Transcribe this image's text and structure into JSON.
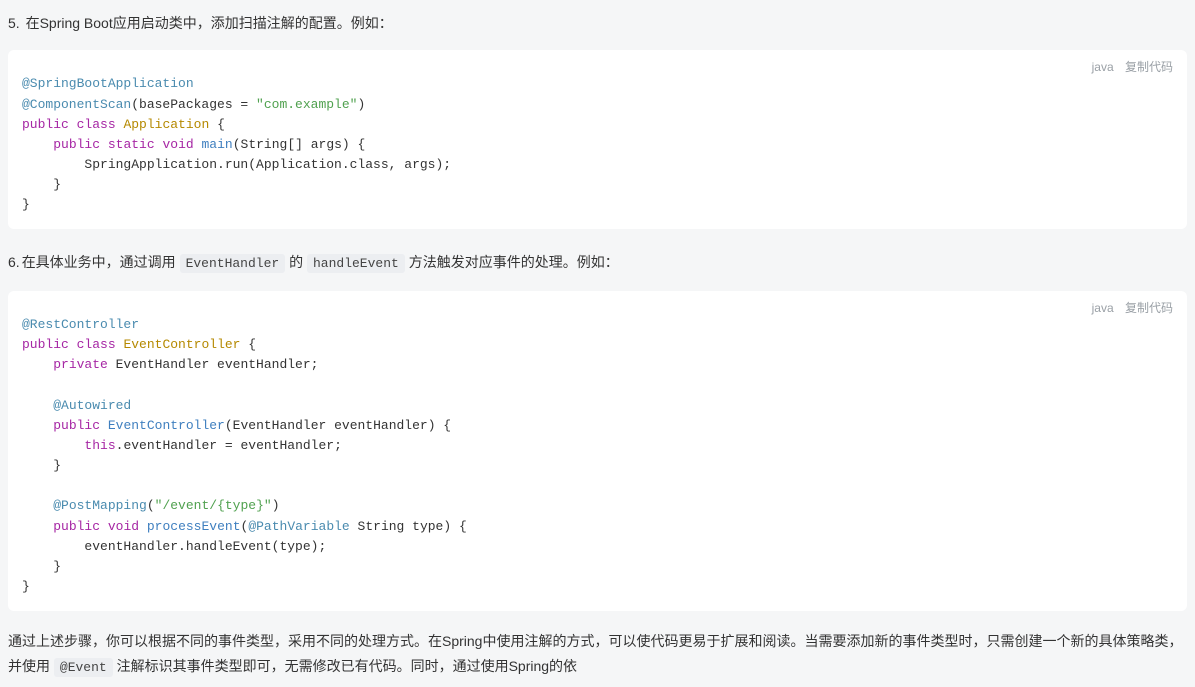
{
  "step5": {
    "number": "5.",
    "text_before": "在Spring Boot应用启动类中，添加扫描注解的配置。例如：",
    "code_lang": "java",
    "copy_label": "复制代码",
    "code_tokens": [
      [
        [
          "@SpringBootApplication",
          "annotation"
        ]
      ],
      [
        [
          "@ComponentScan",
          "annotation"
        ],
        [
          "(basePackages = ",
          "plain"
        ],
        [
          "\"com.example\"",
          "string"
        ],
        [
          ")",
          "plain"
        ]
      ],
      [
        [
          "public",
          "keyword"
        ],
        [
          " ",
          "plain"
        ],
        [
          "class",
          "keyword"
        ],
        [
          " ",
          "plain"
        ],
        [
          "Application",
          "type"
        ],
        [
          " {",
          "plain"
        ]
      ],
      [
        [
          "    ",
          "plain"
        ],
        [
          "public",
          "keyword"
        ],
        [
          " ",
          "plain"
        ],
        [
          "static",
          "keyword"
        ],
        [
          " ",
          "plain"
        ],
        [
          "void",
          "keyword"
        ],
        [
          " ",
          "plain"
        ],
        [
          "main",
          "method"
        ],
        [
          "(String[] args) {",
          "plain"
        ]
      ],
      [
        [
          "        SpringApplication.run(Application.class, args);",
          "plain"
        ]
      ],
      [
        [
          "    }",
          "plain"
        ]
      ],
      [
        [
          "}",
          "plain"
        ]
      ]
    ]
  },
  "step6": {
    "number": "6.",
    "text_parts": [
      {
        "t": "在具体业务中，通过调用 ",
        "code": false
      },
      {
        "t": "EventHandler",
        "code": true
      },
      {
        "t": " 的 ",
        "code": false
      },
      {
        "t": "handleEvent",
        "code": true
      },
      {
        "t": " 方法触发对应事件的处理。例如：",
        "code": false
      }
    ],
    "code_lang": "java",
    "copy_label": "复制代码",
    "code_tokens": [
      [
        [
          "@RestController",
          "annotation"
        ]
      ],
      [
        [
          "public",
          "keyword"
        ],
        [
          " ",
          "plain"
        ],
        [
          "class",
          "keyword"
        ],
        [
          " ",
          "plain"
        ],
        [
          "EventController",
          "type"
        ],
        [
          " {",
          "plain"
        ]
      ],
      [
        [
          "    ",
          "plain"
        ],
        [
          "private",
          "keyword"
        ],
        [
          " EventHandler eventHandler;",
          "plain"
        ]
      ],
      [
        [
          "",
          "plain"
        ]
      ],
      [
        [
          "    ",
          "plain"
        ],
        [
          "@Autowired",
          "annotation"
        ]
      ],
      [
        [
          "    ",
          "plain"
        ],
        [
          "public",
          "keyword"
        ],
        [
          " ",
          "plain"
        ],
        [
          "EventController",
          "method"
        ],
        [
          "(EventHandler eventHandler) {",
          "plain"
        ]
      ],
      [
        [
          "        ",
          "plain"
        ],
        [
          "this",
          "keyword"
        ],
        [
          ".eventHandler = eventHandler;",
          "plain"
        ]
      ],
      [
        [
          "    }",
          "plain"
        ]
      ],
      [
        [
          "",
          "plain"
        ]
      ],
      [
        [
          "    ",
          "plain"
        ],
        [
          "@PostMapping",
          "annotation"
        ],
        [
          "(",
          "plain"
        ],
        [
          "\"/event/{type}\"",
          "string"
        ],
        [
          ")",
          "plain"
        ]
      ],
      [
        [
          "    ",
          "plain"
        ],
        [
          "public",
          "keyword"
        ],
        [
          " ",
          "plain"
        ],
        [
          "void",
          "keyword"
        ],
        [
          " ",
          "plain"
        ],
        [
          "processEvent",
          "method"
        ],
        [
          "(",
          "plain"
        ],
        [
          "@PathVariable",
          "annotation"
        ],
        [
          " String type) {",
          "plain"
        ]
      ],
      [
        [
          "        eventHandler.handleEvent(type);",
          "plain"
        ]
      ],
      [
        [
          "    }",
          "plain"
        ]
      ],
      [
        [
          "}",
          "plain"
        ]
      ]
    ]
  },
  "closing": {
    "parts": [
      {
        "t": "通过上述步骤，你可以根据不同的事件类型，采用不同的处理方式。在Spring中使用注解的方式，可以使代码更易于扩展和阅读。当需要添加新的事件类型时，只需创建一个新的具体策略类，并使用 ",
        "code": false
      },
      {
        "t": "@Event",
        "code": true
      },
      {
        "t": " 注解标识其事件类型即可，无需修改已有代码。同时，通过使用Spring的依",
        "code": false
      }
    ]
  }
}
